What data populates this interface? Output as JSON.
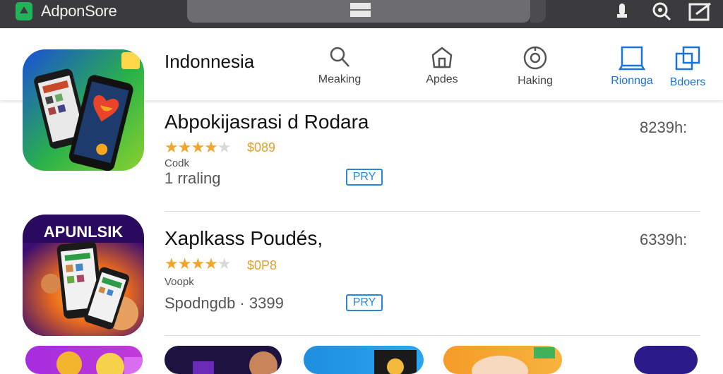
{
  "window": {
    "title": "AdponSore",
    "icons": [
      "microphone-icon",
      "search-icon",
      "edit-icon"
    ]
  },
  "header": {
    "title": "Indonnesia",
    "categories": [
      {
        "label": "Meaking",
        "icon": "search-icon"
      },
      {
        "label": "Apdes",
        "icon": "bag-icon"
      },
      {
        "label": "Haking",
        "icon": "clock-icon"
      },
      {
        "label": "Rionnga",
        "icon": "bookmark-icon",
        "active": true
      },
      {
        "label": "Bdoers",
        "icon": "copy-icon",
        "active": true
      }
    ]
  },
  "apps": [
    {
      "name": "Abpokijasrasi d Rodara",
      "rating": "4 of 5 stars",
      "price": "$089",
      "small": "Codk",
      "meta": "1 rraling",
      "button": "PRY",
      "size": "8239h:"
    },
    {
      "name": "Xaplkass Poudés,",
      "icon_text": "APUNLSIK",
      "rating": "4 of 5 stars",
      "price": "$0P8",
      "small": "Voopk",
      "meta": "Spodngdb  ·  3399",
      "button": "PRY",
      "size": "6339h:"
    }
  ],
  "colors": {
    "accent_blue": "#1a73d8",
    "star_gold": "#f1a62b",
    "topbar": "#3b3b3d"
  }
}
